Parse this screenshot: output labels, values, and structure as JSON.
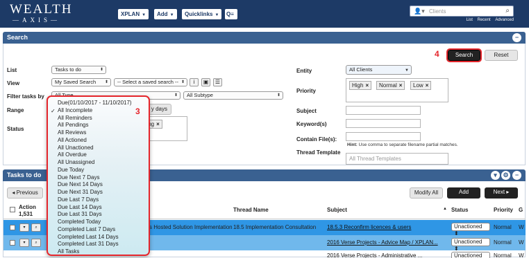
{
  "brand": {
    "line1": "WEALTH",
    "line2": "AXIS"
  },
  "nav": {
    "xplan": "XPLAN",
    "add": "Add",
    "quicklinks": "Quicklinks",
    "quicklinks_icon": "search-list-icon"
  },
  "client_search": {
    "placeholder": "Clients",
    "links": [
      "List",
      "Recent",
      "Advanced"
    ]
  },
  "search_panel": {
    "title": "Search",
    "labels": {
      "list": "List",
      "view": "View",
      "filter": "Filter tasks by",
      "range": "Range",
      "status": "Status",
      "entity": "Entity",
      "priority": "Priority",
      "subject": "Subject",
      "keywords": "Keyword(s)",
      "contain_files": "Contain File(s):",
      "thread_template": "Thread Template"
    },
    "list_value": "Tasks to do",
    "view_value": "My Saved Search",
    "saved_search_placeholder": "-- Select a saved search --",
    "filter_type": "All Type",
    "filter_subtype": "All Subtype",
    "range_button_tail": "y days",
    "status_tag_tail": "ding",
    "entity_value": "All Clients",
    "priority_tags": [
      "High",
      "Normal",
      "Low"
    ],
    "hint_bold": "Hint:",
    "hint_text": "Use comma to separate filename partial matches.",
    "thread_template_placeholder": "All Thread Templates",
    "search_button": "Search",
    "reset_button": "Reset",
    "annotation_4": "4",
    "annotation_3": "3"
  },
  "range_dropdown": {
    "selected": "All Incomplete",
    "options": [
      "Due(01/10/2017 - 11/10/2017)",
      "All Incomplete",
      "All Reminders",
      "All Pendings",
      "All Reviews",
      "All Actioned",
      "All Unactioned",
      "All Overdue",
      "All Unassigned",
      "Due Today",
      "Due Next 7 Days",
      "Due Next 14 Days",
      "Due Next 31 Days",
      "Due Last 7 Days",
      "Due Last 14 Days",
      "Due Last 31 Days",
      "Completed Today",
      "Completed Last 7 Days",
      "Completed Last 14 Days",
      "Completed Last 31 Days",
      "All Tasks"
    ]
  },
  "tasks_panel": {
    "title": "Tasks to do",
    "previous": "Previous",
    "modify_all": "Modify All",
    "add": "Add",
    "next": "Next",
    "columns": {
      "action": "Action",
      "count": "1,531",
      "thread_name": "Thread Name",
      "subject": "Subject",
      "status": "Status",
      "priority": "Priority",
      "trail": "G"
    },
    "rows": [
      {
        "desc_tail": "s Hosted Solution Implementation",
        "thread": "18.5 Implementation Consultation",
        "subject": "18.5.3 Reconfirm licences & users",
        "status": "Unactioned",
        "priority": "Normal",
        "trail": "W"
      },
      {
        "desc_tail": "",
        "thread": "",
        "subject": "2016 Verse Projects - Advice Map / XPLAN...",
        "status": "Unactioned",
        "priority": "Normal",
        "trail": "W"
      },
      {
        "desc_tail": "",
        "thread": "",
        "subject": "2016 Verse Projects - Administrative ...",
        "status": "Unactioned",
        "priority": "Normal",
        "trail": "W"
      }
    ]
  }
}
